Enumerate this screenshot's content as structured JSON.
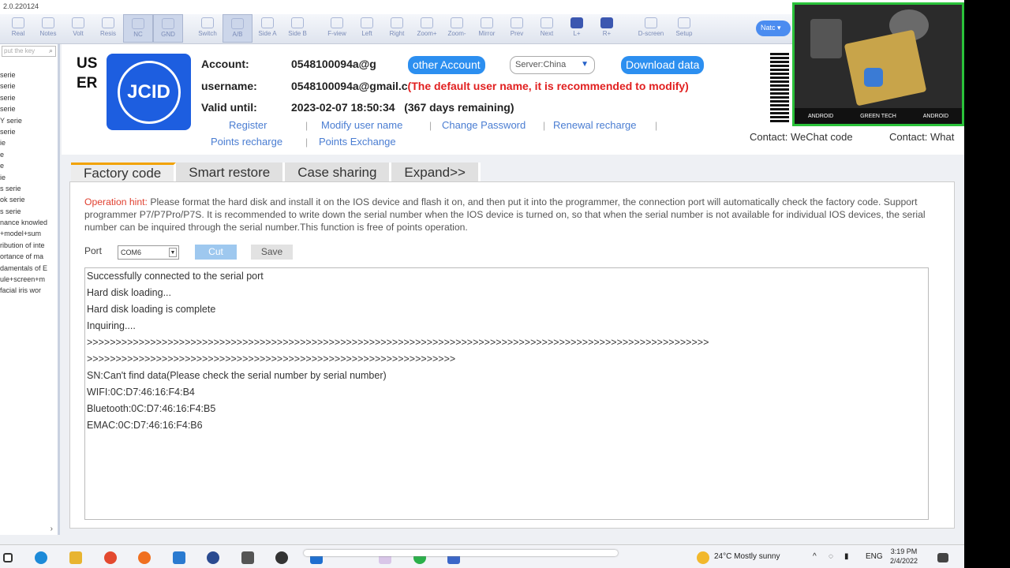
{
  "window": {
    "title": "2.0.220124"
  },
  "toolbar": {
    "buttons": [
      "Real",
      "Notes",
      "Volt",
      "Resis",
      "NC",
      "GND",
      "Switch",
      "A/B",
      "Side A",
      "Side B",
      "F-view",
      "Left",
      "Right",
      "Zoom+",
      "Zoom-",
      "Mirror",
      "Prev",
      "Next",
      "L+",
      "R+",
      "D-screen",
      "Setup"
    ],
    "natc": "Natc"
  },
  "sidebar": {
    "search_placeholder": "put the key",
    "items": [
      "serie",
      "serie",
      "serie",
      "serie",
      "Y serie",
      "serie",
      "ie",
      "e",
      "e",
      "ie",
      "s serie",
      "ok serie",
      "s serie",
      "nance knowled",
      "+model+sum",
      "ribution of inte",
      "ortance of ma",
      "damentals of E",
      "ule+screen+m",
      "facial iris wor"
    ]
  },
  "user": {
    "label": "US ER",
    "logo_text": "JCID",
    "account_label": "Account:",
    "account_value": "0548100094a@g",
    "username_label": "username:",
    "username_value": "0548100094a@gmail.c",
    "username_warning": "(The default user name, it is recommended to modify)",
    "valid_label": "Valid until:",
    "valid_value": "2023-02-07 18:50:34",
    "days_remaining": "(367 days remaining)",
    "other_account": "other Account",
    "server": "Server:China",
    "download": "Download data",
    "links": {
      "register": "Register",
      "modify": "Modify user name",
      "password": "Change Password",
      "renewal": "Renewal recharge",
      "points_recharge": "Points recharge",
      "points_exchange": "Points Exchange"
    },
    "contact_wechat": "Contact: WeChat code",
    "contact_what": "Contact: What"
  },
  "camera": {
    "hud_left": "ANDROID",
    "hud_center": "GREEN TECH",
    "hud_right": "ANDROID"
  },
  "tabs": [
    "Factory code",
    "Smart restore",
    "Case sharing",
    "Expand>>"
  ],
  "factory": {
    "hint_label": "Operation hint:",
    "hint_text": " Please format the hard disk and install it on the IOS device and flash it on, and then put it into the programmer, the connection port will automatically check the factory code. Support programmer P7/P7Pro/P7S. It is recommended to write down the serial number when the IOS device is turned on, so that when the serial number is not available for individual IOS devices, the serial number can be inquired through the serial number.This function is free of points operation.",
    "port_label": "Port",
    "port_value": "COM6",
    "cut": "Cut",
    "save": "Save",
    "log": [
      "Successfully connected to the serial port",
      "Hard disk loading...",
      "Hard disk loading is complete",
      "Inquiring....",
      ">>>>>>>>>>>>>>>>>>>>>>>>>>>>>>>>>>>>>>>>>>>>>>>>>>>>>>>>>>>>>>>>>>>>>>>>>>>>>>>>>>>>>>>>>>>>>>>>>>>>>>>>>>>>",
      ">>>>>>>>>>>>>>>>>>>>>>>>>>>>>>>>>>>>>>>>>>>>>>>>>>>>>>>>>>>>>>>>",
      "SN:Can't find data(Please check the serial number by serial number)",
      "WIFI:0C:D7:46:16:F4:B4",
      "Bluetooth:0C:D7:46:16:F4:B5",
      "EMAC:0C:D7:46:16:F4:B6"
    ]
  },
  "taskbar": {
    "weather": "24°C  Mostly sunny",
    "lang": "ENG",
    "time": "3:19 PM",
    "date": "2/4/2022"
  },
  "colors": {
    "accent": "#2c8ff0",
    "logo": "#1d5ee0",
    "warning": "#e12020",
    "tab_active": "#f2a200"
  }
}
